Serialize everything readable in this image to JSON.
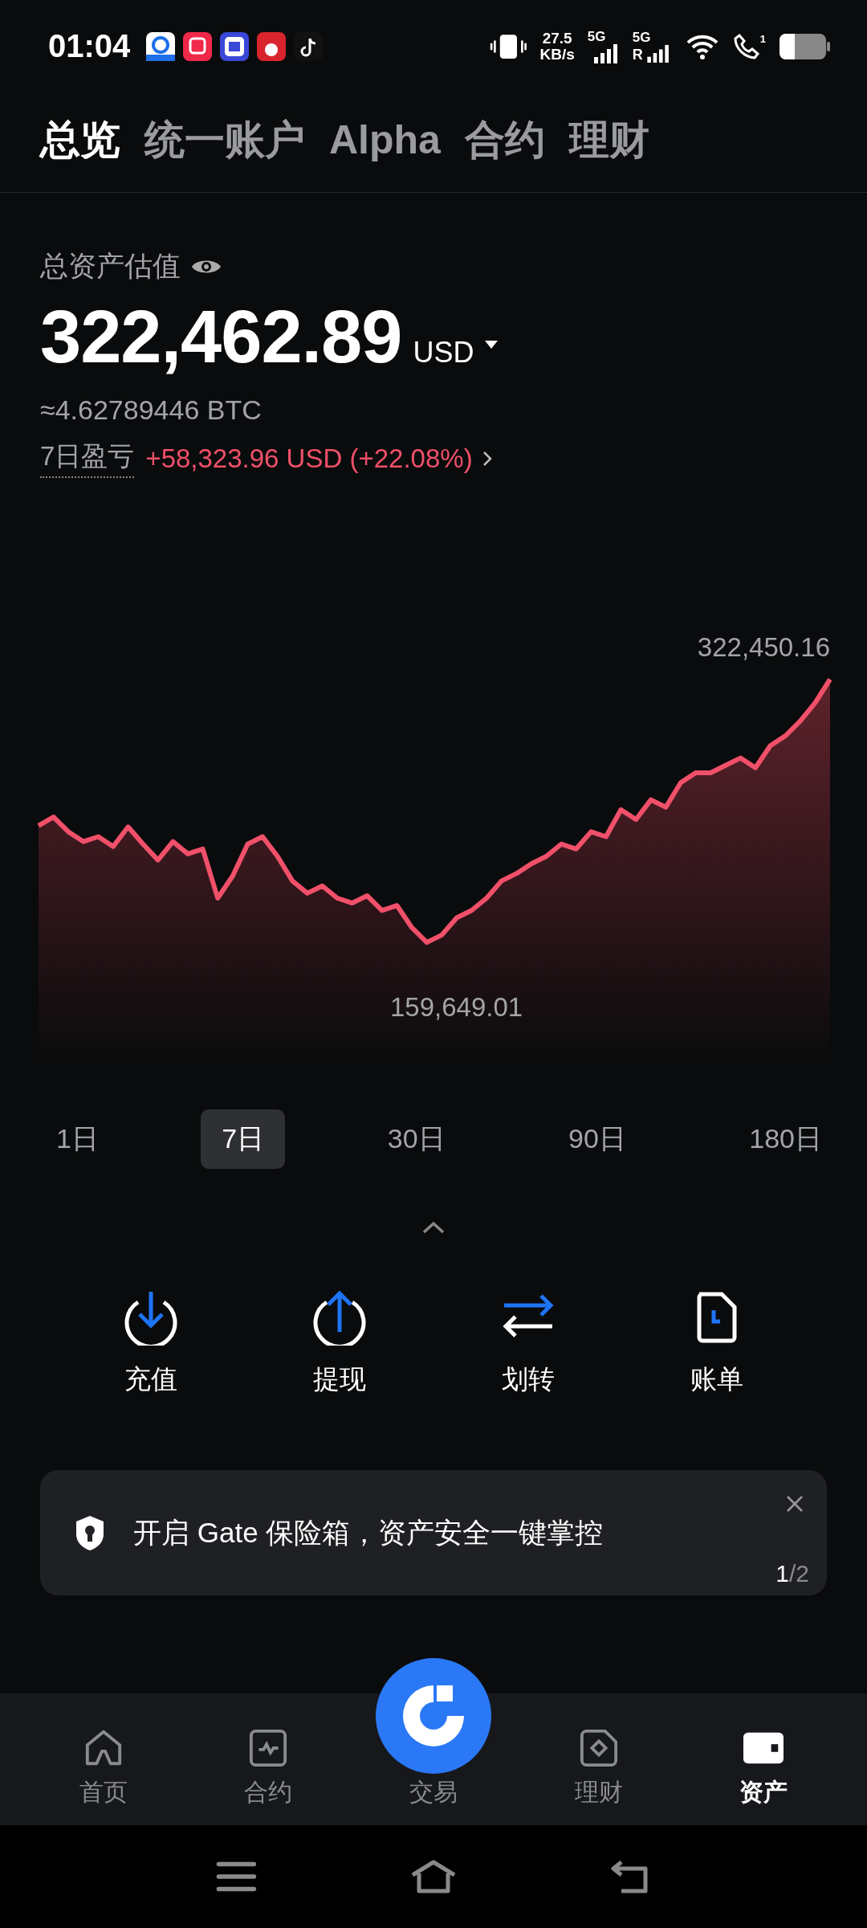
{
  "status_bar": {
    "time": "01:04",
    "net_speed": "27.5",
    "net_unit": "KB/s",
    "sim1": "5G",
    "sim2": "5G",
    "roaming": "R",
    "call_sub": "1"
  },
  "tabs": [
    {
      "label": "总览",
      "selected": true
    },
    {
      "label": "统一账户",
      "selected": false
    },
    {
      "label": "Alpha",
      "selected": false
    },
    {
      "label": "合约",
      "selected": false
    },
    {
      "label": "理财",
      "selected": false
    }
  ],
  "summary": {
    "label": "总资产估值",
    "amount": "322,462.89",
    "currency": "USD",
    "btc": "≈4.62789446 BTC",
    "pnl_label": "7日盈亏",
    "pnl_value": "+58,323.96 USD (+22.08%)"
  },
  "chart": {
    "high_label": "322,450.16",
    "low_label": "159,649.01"
  },
  "periods": [
    {
      "label": "1日",
      "selected": false
    },
    {
      "label": "7日",
      "selected": true
    },
    {
      "label": "30日",
      "selected": false
    },
    {
      "label": "90日",
      "selected": false
    },
    {
      "label": "180日",
      "selected": false
    }
  ],
  "actions": [
    {
      "kind": "deposit",
      "label": "充值"
    },
    {
      "kind": "withdraw",
      "label": "提现"
    },
    {
      "kind": "transfer",
      "label": "划转"
    },
    {
      "kind": "bill",
      "label": "账单"
    }
  ],
  "banner": {
    "text": "开启 Gate 保险箱，资产安全一键掌控",
    "page_current": "1",
    "page_total": "/2"
  },
  "bottom_nav": [
    {
      "kind": "home",
      "label": "首页",
      "selected": false
    },
    {
      "kind": "futures",
      "label": "合约",
      "selected": false
    },
    {
      "kind": "trade",
      "label": "交易",
      "selected": false
    },
    {
      "kind": "finance",
      "label": "理财",
      "selected": false
    },
    {
      "kind": "wallet",
      "label": "资产",
      "selected": true
    }
  ]
}
